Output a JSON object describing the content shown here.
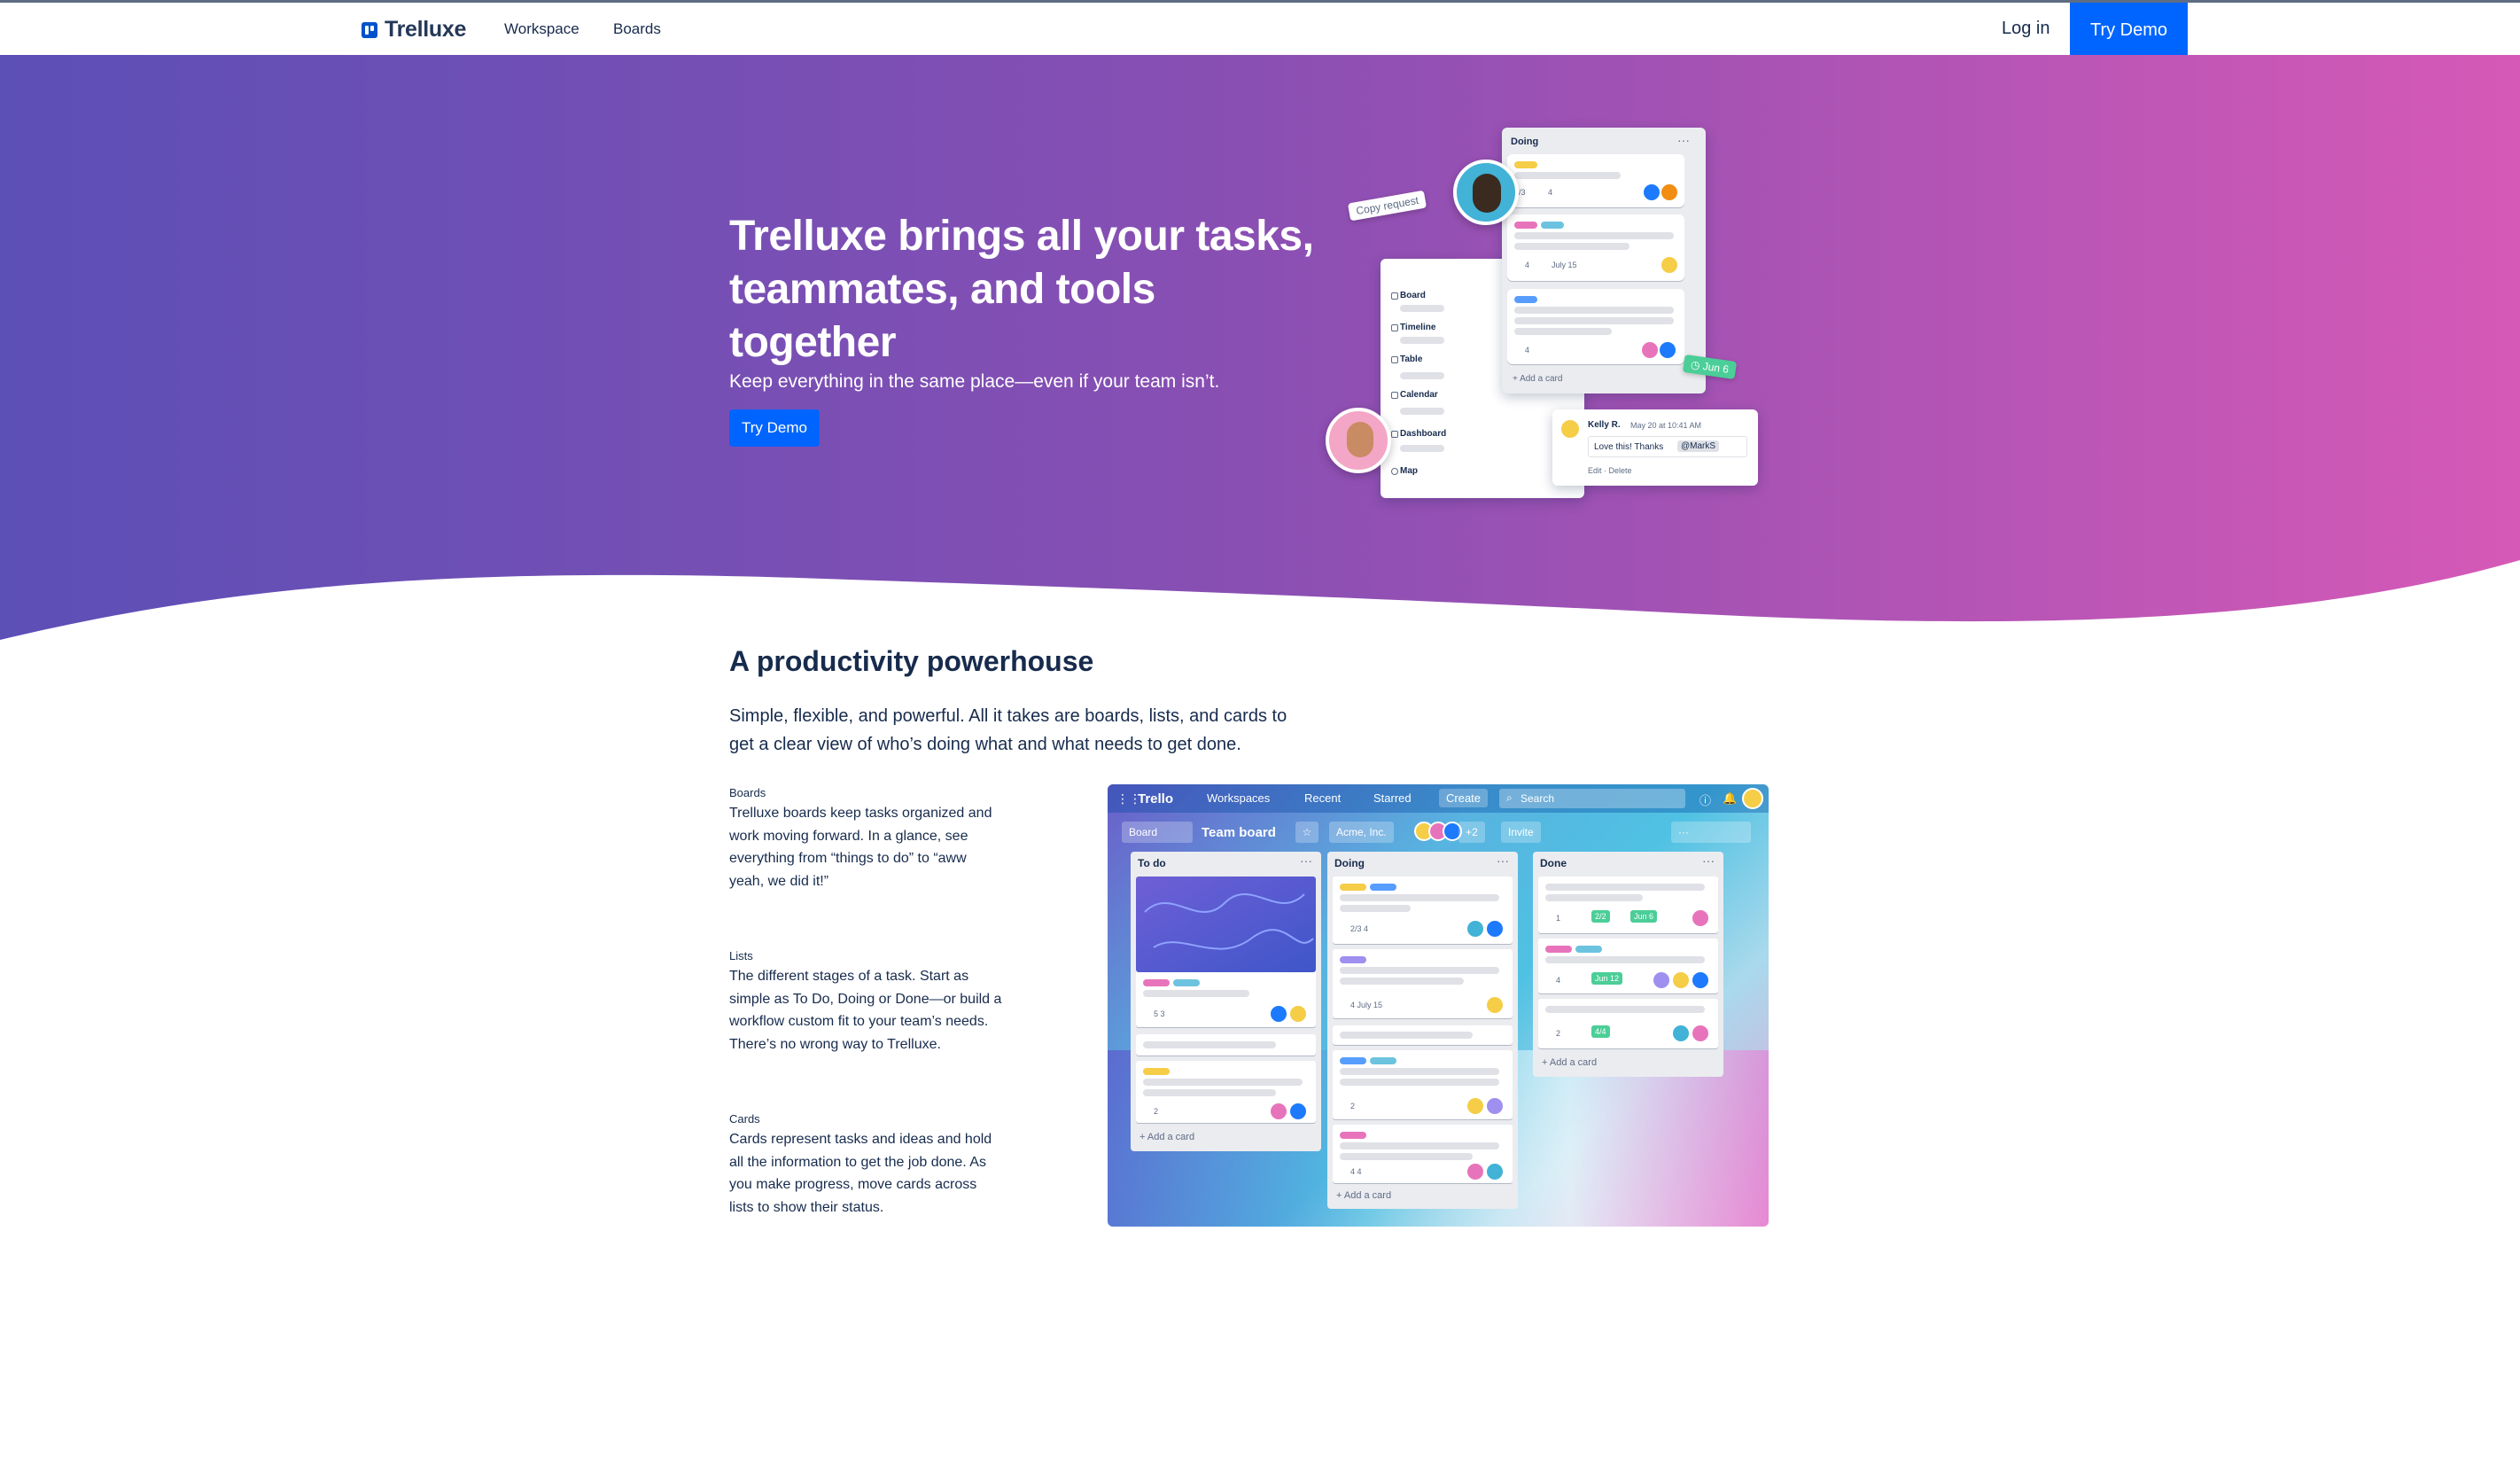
{
  "nav": {
    "logo": "Trelluxe",
    "links": [
      "Workspace",
      "Boards"
    ],
    "login": "Log in",
    "try_demo": "Try Demo"
  },
  "hero": {
    "title": "Trelluxe brings all your tasks, teammates, and tools together",
    "subtitle": "Keep everything in the same place—even if your team isn’t.",
    "cta": "Try Demo",
    "illustration": {
      "copy_request": "Copy request",
      "list_title": "Doing",
      "sidebar": [
        "Board",
        "Timeline",
        "Table",
        "Calendar",
        "Dashboard",
        "Map"
      ],
      "card1_meta": "2/3",
      "card1_attach": "4",
      "card2_attach": "4",
      "card2_date": "July 15",
      "card3_attach": "4",
      "add_card": "+ Add a card",
      "due_tag": "Jun 6",
      "comment_author": "Kelly R.",
      "comment_time": "May 20 at 10:41 AM",
      "comment_text": "Love this! Thanks",
      "comment_mention": "@MarkS",
      "comment_actions": "Edit · Delete"
    }
  },
  "section": {
    "title": "A productivity powerhouse",
    "text": "Simple, flexible, and powerful. All it takes are boards, lists, and cards to get a clear view of who’s doing what and what needs to get done.",
    "features": [
      {
        "title": "Boards",
        "text": "Trelluxe boards keep tasks organized and work moving forward. In a glance, see everything from “things to do” to “aww yeah, we did it!”"
      },
      {
        "title": "Lists",
        "text": "The different stages of a task. Start as simple as To Do, Doing or Done—or build a workflow custom fit to your team’s needs. There’s no wrong way to Trelluxe."
      },
      {
        "title": "Cards",
        "text": "Cards represent tasks and ideas and hold all the information to get the job done. As you make progress, move cards across lists to show their status."
      }
    ]
  },
  "board": {
    "app": "Trello",
    "menu": [
      "Workspaces",
      "Recent",
      "Starred"
    ],
    "create": "Create",
    "search": "Search",
    "view": "Board",
    "name": "Team board",
    "workspace": "Acme, Inc.",
    "members_more": "+2",
    "invite": "Invite",
    "lists": [
      {
        "name": "To do",
        "add": "+ Add a card"
      },
      {
        "name": "Doing",
        "add": "+ Add a card"
      },
      {
        "name": "Done",
        "add": "+ Add a card"
      }
    ],
    "meta": {
      "todo1": "5  3",
      "todo3": "2",
      "doing1": "2/3  4",
      "doing2": "4  July 15",
      "doing3": "2",
      "doing4": "4  4",
      "done1": "1",
      "done1_check": "2/2",
      "done1_date": "Jun 6",
      "done2": "4",
      "done2_date": "Jun 12",
      "done3": "2",
      "done3_check": "4/4"
    }
  },
  "colors": {
    "brand": "#0065ff",
    "hero_start": "#5c4fb6",
    "hero_end": "#d659b7",
    "text": "#172b4d"
  }
}
